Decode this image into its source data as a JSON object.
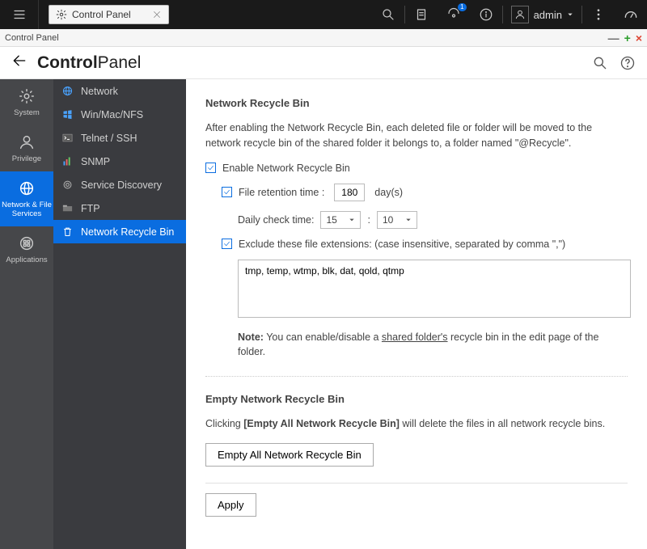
{
  "topbar": {
    "tab_label": "Control Panel",
    "admin_label": "admin",
    "notify_count": "1"
  },
  "winlabel": {
    "title": "Control Panel"
  },
  "titlebar": {
    "bold": "Control",
    "light": "Panel"
  },
  "rail": {
    "items": [
      {
        "label": "System"
      },
      {
        "label": "Privilege"
      },
      {
        "label": "Network & File Services"
      },
      {
        "label": "Applications"
      }
    ]
  },
  "sidebar": {
    "items": [
      {
        "label": "Network"
      },
      {
        "label": "Win/Mac/NFS"
      },
      {
        "label": "Telnet / SSH"
      },
      {
        "label": "SNMP"
      },
      {
        "label": "Service Discovery"
      },
      {
        "label": "FTP"
      },
      {
        "label": "Network Recycle Bin"
      }
    ]
  },
  "content": {
    "section1_title": "Network Recycle Bin",
    "section1_desc": "After enabling the Network Recycle Bin, each deleted file or folder will be moved to the network recycle bin of the shared folder it belongs to, a folder named \"@Recycle\".",
    "enable_label": "Enable Network Recycle Bin",
    "retention_label": "File retention time :",
    "retention_value": "180",
    "retention_unit": "day(s)",
    "dailycheck_label": "Daily check time:",
    "dailycheck_hour": "15",
    "dailycheck_min": "10",
    "exclude_label": "Exclude these file extensions: (case insensitive, separated by comma \",\")",
    "exclude_value": "tmp, temp, wtmp, blk, dat, qold, qtmp",
    "note_bold": "Note:",
    "note_pre": " You can enable/disable a ",
    "note_ul": "shared folder's",
    "note_post": " recycle bin in the edit page of the folder.",
    "section2_title": "Empty Network Recycle Bin",
    "section2_pretext": "Clicking ",
    "section2_bold": "[Empty All Network Recycle Bin]",
    "section2_post": " will delete the files in all network recycle bins.",
    "empty_btn": "Empty All Network Recycle Bin",
    "apply_btn": "Apply"
  }
}
